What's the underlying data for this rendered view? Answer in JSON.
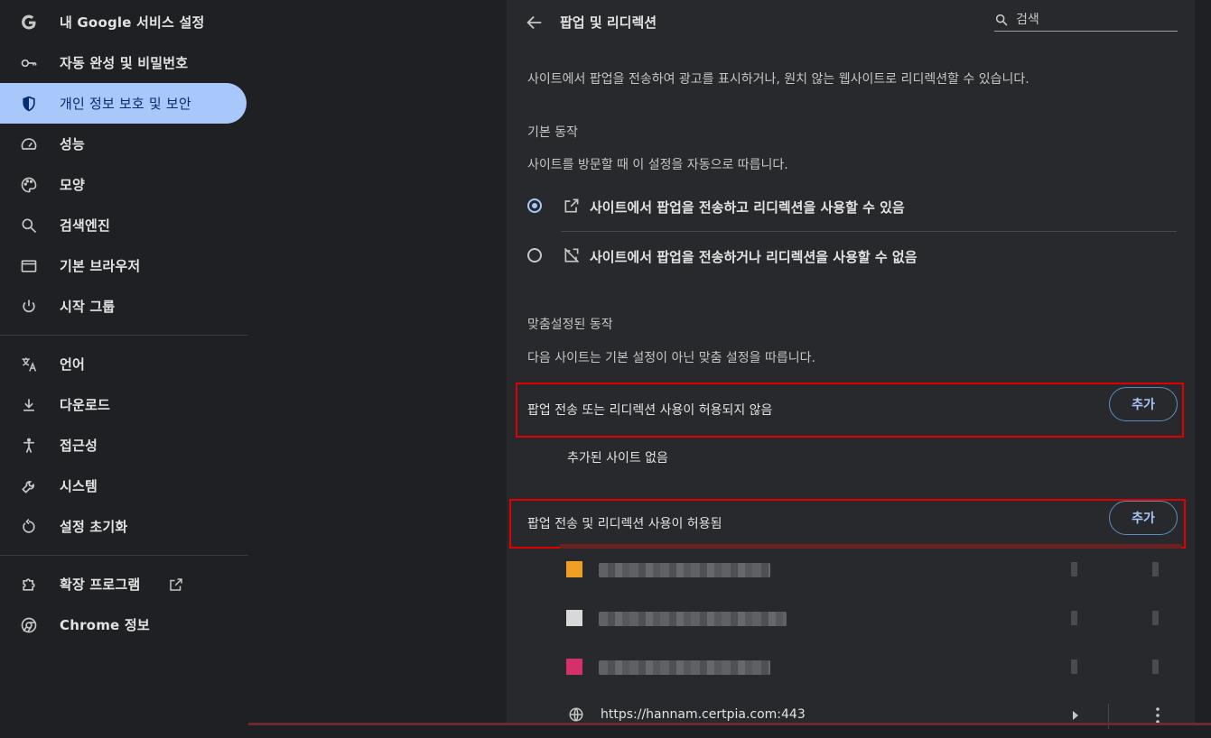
{
  "sidebar": {
    "items": [
      {
        "label": "내 Google 서비스 설정",
        "icon": "google-icon",
        "active": false
      },
      {
        "label": "자동 완성 및 비밀번호",
        "icon": "key-icon",
        "active": false
      },
      {
        "label": "개인 정보 보호 및 보안",
        "icon": "shield-icon",
        "active": true
      },
      {
        "label": "성능",
        "icon": "speedometer-icon",
        "active": false
      },
      {
        "label": "모양",
        "icon": "palette-icon",
        "active": false
      },
      {
        "label": "검색엔진",
        "icon": "search-icon",
        "active": false
      },
      {
        "label": "기본 브라우저",
        "icon": "browser-window-icon",
        "active": false
      },
      {
        "label": "시작 그룹",
        "icon": "power-icon",
        "active": false
      },
      {
        "label": "언어",
        "icon": "translate-icon",
        "active": false
      },
      {
        "label": "다운로드",
        "icon": "download-icon",
        "active": false
      },
      {
        "label": "접근성",
        "icon": "accessibility-icon",
        "active": false
      },
      {
        "label": "시스템",
        "icon": "wrench-icon",
        "active": false
      },
      {
        "label": "설정 초기화",
        "icon": "reset-icon",
        "active": false
      },
      {
        "label": "확장 프로그램",
        "icon": "puzzle-icon",
        "active": false
      },
      {
        "label": "Chrome 정보",
        "icon": "chrome-icon",
        "active": false
      }
    ]
  },
  "header": {
    "title": "팝업 및 리디렉션",
    "search_placeholder": "검색"
  },
  "content": {
    "description": "사이트에서 팝업을 전송하여 광고를 표시하거나, 원치 않는 웹사이트로 리디렉션할 수 있습니다.",
    "default_heading": "기본 동작",
    "default_sub": "사이트를 방문할 때 이 설정을 자동으로 따릅니다.",
    "option_allow": "사이트에서 팝업을 전송하고 리디렉션을 사용할 수 있음",
    "option_block": "사이트에서 팝업을 전송하거나 리디렉션을 사용할 수 없음",
    "selected_option": "allow",
    "custom_heading": "맞춤설정된 동작",
    "custom_sub": "다음 사이트는 기본 설정이 아닌 맞춤 설정을 따릅니다.",
    "blocked_section_title": "팝업 전송 또는 리디렉션 사용이 허용되지 않음",
    "blocked_add_label": "추가",
    "blocked_empty": "추가된 사이트 없음",
    "allowed_section_title": "팝업 전송 및 리디렉션 사용이 허용됨",
    "allowed_add_label": "추가",
    "allowed_sites": [
      {
        "favicon_color": "#f0a020",
        "obscured": true
      },
      {
        "favicon_color": "#d8d8d8",
        "obscured": true
      },
      {
        "favicon_color": "#d4306a",
        "obscured": true
      },
      {
        "url": "https://hannam.certpia.com:443",
        "obscured": false
      }
    ]
  },
  "colors": {
    "accent": "#a8c7fa",
    "highlight_border": "#e00000",
    "panel_bg": "#28292c",
    "page_bg": "#1f2023"
  }
}
